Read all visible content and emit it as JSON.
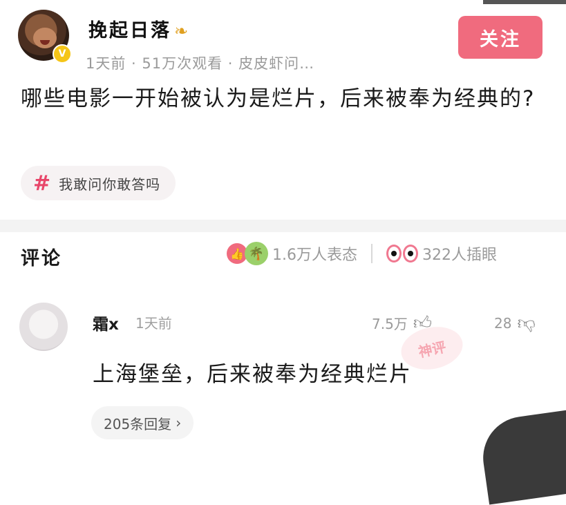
{
  "post": {
    "author": "挽起日落",
    "meta": "1天前 · 51万次观看 · 皮皮虾问…",
    "follow_label": "关注",
    "question": "哪些电影一开始被认为是烂片，后来被奉为经典的?",
    "tag": "我敢问你敢答吗"
  },
  "comments_section": {
    "title": "评论",
    "reactions_count": "1.6万人表态",
    "plugs_count": "322人插眼"
  },
  "comment": {
    "author": "霜x",
    "time": "1天前",
    "likes": "7.5万",
    "dislikes": "28",
    "text": "上海堡垒，后来被奉为经典烂片",
    "replies": "205条回复",
    "watermark": "神评"
  },
  "icons": {
    "verified": "verified-badge-icon",
    "hash": "hash-icon",
    "like": "thumbs-up-icon",
    "dislike": "thumbs-down-icon",
    "eyes": "eyes-icon"
  },
  "colors": {
    "accent": "#f06b7e",
    "tag_hash": "#e8466a",
    "muted_text": "#9a9a9a"
  }
}
